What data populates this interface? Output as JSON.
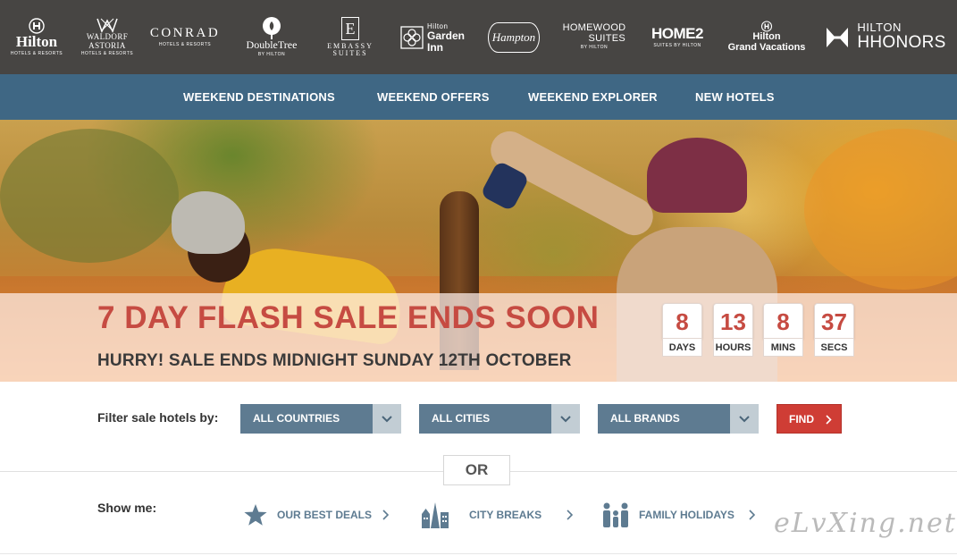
{
  "brands": {
    "hilton": {
      "line1": "Hilton",
      "line2": "HOTELS & RESORTS"
    },
    "waldorf": {
      "line1": "WALDORF",
      "line2": "ASTORIA",
      "line3": "HOTELS & RESORTS"
    },
    "conrad": {
      "line1": "CONRAD",
      "line2": "HOTELS & RESORTS"
    },
    "doubletree": {
      "line1": "DoubleTree",
      "line2": "BY HILTON"
    },
    "embassy": {
      "letter": "E",
      "line1": "EMBASSY",
      "line2": "SUITES"
    },
    "garden": {
      "line1": "Hilton",
      "line2": "Garden",
      "line3": "Inn"
    },
    "hampton": {
      "line1": "Hampton"
    },
    "homewood": {
      "line1": "HOMEWOOD",
      "line2": "SUITES",
      "line3": "BY HILTON"
    },
    "home2": {
      "line1": "HOME2",
      "line2": "SUITES BY HILTON"
    },
    "grandvac": {
      "line1": "Hilton",
      "line2": "Grand Vacations"
    },
    "hhonors": {
      "line1": "HILTON",
      "line2": "HHONORS"
    }
  },
  "nav": {
    "items": [
      {
        "label": "WEEKEND DESTINATIONS"
      },
      {
        "label": "WEEKEND OFFERS"
      },
      {
        "label": "WEEKEND EXPLORER"
      },
      {
        "label": "NEW HOTELS"
      }
    ]
  },
  "hero": {
    "title": "7 DAY FLASH SALE ENDS SOON",
    "subtitle": "HURRY! SALE ENDS MIDNIGHT SUNDAY 12TH OCTOBER",
    "countdown": [
      {
        "value": "8",
        "label": "DAYS"
      },
      {
        "value": "13",
        "label": "HOURS"
      },
      {
        "value": "8",
        "label": "MINS"
      },
      {
        "value": "37",
        "label": "SECS"
      }
    ]
  },
  "filter": {
    "label": "Filter sale hotels by:",
    "countries": "ALL COUNTRIES",
    "cities": "ALL CITIES",
    "brands": "ALL BRANDS",
    "find": "FIND",
    "or": "OR"
  },
  "show_me": {
    "label": "Show me:",
    "links": [
      {
        "label": "OUR BEST DEALS",
        "icon": "star-icon"
      },
      {
        "label": "CITY BREAKS",
        "icon": "city-skyline-icon"
      },
      {
        "label": "FAMILY HOLIDAYS",
        "icon": "family-icon"
      }
    ]
  },
  "watermark": "eLvXing.net",
  "colors": {
    "brand_bar": "#474543",
    "nav": "#3f6784",
    "sale_red": "#c64b42",
    "select_blue": "#5e7b91",
    "find_red": "#cf3d35"
  }
}
